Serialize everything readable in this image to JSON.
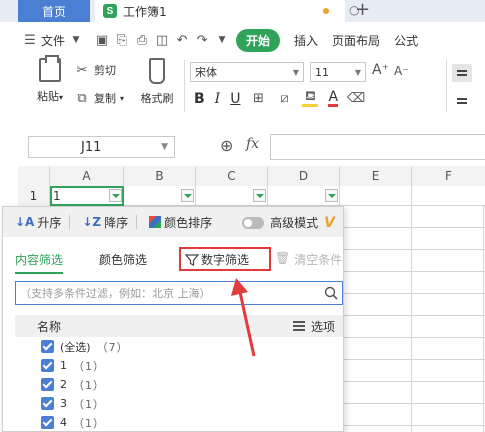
{
  "titlebar": {
    "home_tab": "首页",
    "doc_icon": "S",
    "doc_tab": "工作簿1",
    "new_tab": "+",
    "close": "○"
  },
  "menubar": {
    "file_label": "文件",
    "start_label": "开始",
    "items": [
      "插入",
      "页面布局",
      "公式"
    ]
  },
  "ribbon": {
    "paste_label": "粘贴",
    "cut_label": "剪切",
    "copy_label": "复制",
    "format_painter_label": "格式刷",
    "font_name": "宋体",
    "font_size": "11",
    "grow_label": "A⁺",
    "shrink_label": "A⁻",
    "bold": "B",
    "italic": "I",
    "underline": "U",
    "font_color": "A"
  },
  "formula": {
    "cell_ref": "J11",
    "fx": "fx"
  },
  "sheet": {
    "columns": [
      "A",
      "B",
      "C",
      "D",
      "E",
      "F"
    ],
    "row_number": "1",
    "a1_value": "1"
  },
  "filter_panel": {
    "sort_asc": "升序",
    "sort_desc": "降序",
    "sort_color": "颜色排序",
    "advanced_mode": "高级模式",
    "vip_badge": "V",
    "tab_content": "内容筛选",
    "tab_color": "颜色筛选",
    "tab_number": "数字筛选",
    "clear_label": "清空条件",
    "search_placeholder": "（支持多条件过滤，例如：北京 上海）",
    "list_header": "名称",
    "options_label": "选项",
    "items": [
      {
        "label": "(全选)",
        "count": "（7）"
      },
      {
        "label": "1",
        "count": "（1）"
      },
      {
        "label": "2",
        "count": "（1）"
      },
      {
        "label": "3",
        "count": "（1）"
      },
      {
        "label": "4",
        "count": "（1）"
      }
    ]
  },
  "colors": {
    "accent_green": "#2fa35a",
    "tab_blue": "#4a7fd4",
    "annotation_red": "#e23b3b"
  }
}
